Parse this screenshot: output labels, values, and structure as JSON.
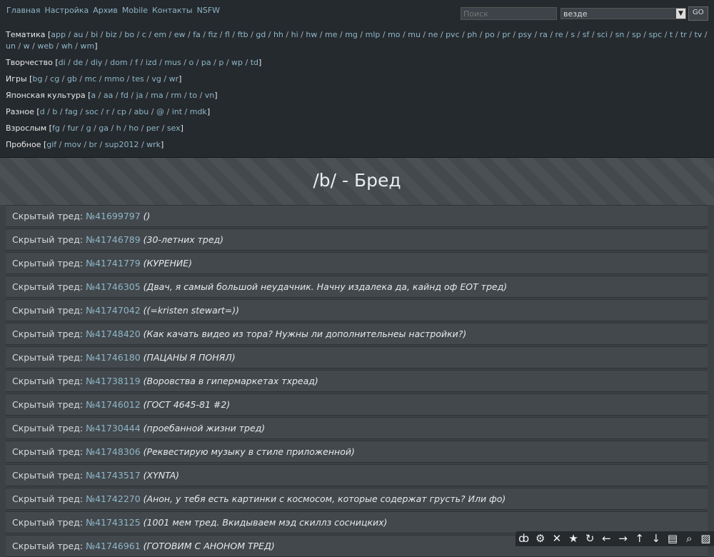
{
  "nav": [
    "Главная",
    "Настройка",
    "Архив",
    "Mobile",
    "Контакты",
    "NSFW"
  ],
  "search": {
    "placeholder": "Поиск",
    "scope": "везде",
    "go": "GO"
  },
  "categories": [
    {
      "label": "Тематика",
      "boards": [
        "app",
        "au",
        "bi",
        "biz",
        "bo",
        "c",
        "em",
        "ew",
        "fa",
        "fiz",
        "fl",
        "ftb",
        "gd",
        "hh",
        "hi",
        "hw",
        "me",
        "mg",
        "mlp",
        "mo",
        "mu",
        "ne",
        "pvc",
        "ph",
        "po",
        "pr",
        "psy",
        "ra",
        "re",
        "s",
        "sf",
        "sci",
        "sn",
        "sp",
        "spc",
        "t",
        "tr",
        "tv",
        "un",
        "w",
        "web",
        "wh",
        "wm"
      ]
    },
    {
      "label": "Творчество",
      "boards": [
        "di",
        "de",
        "diy",
        "dom",
        "f",
        "izd",
        "mus",
        "o",
        "pa",
        "p",
        "wp",
        "td"
      ]
    },
    {
      "label": "Игры",
      "boards": [
        "bg",
        "cg",
        "gb",
        "mc",
        "mmo",
        "tes",
        "vg",
        "wr"
      ]
    },
    {
      "label": "Японская культура",
      "boards": [
        "a",
        "aa",
        "fd",
        "ja",
        "ma",
        "rm",
        "to",
        "vn"
      ]
    },
    {
      "label": "Разное",
      "boards": [
        "d",
        "b",
        "fag",
        "soc",
        "r",
        "cp",
        "abu",
        "@",
        "int",
        "mdk"
      ]
    },
    {
      "label": "Взрослым",
      "boards": [
        "fg",
        "fur",
        "g",
        "ga",
        "h",
        "ho",
        "per",
        "sex"
      ]
    },
    {
      "label": "Пробное",
      "boards": [
        "gif",
        "mov",
        "br",
        "sup2012",
        "wrk"
      ]
    }
  ],
  "board_title": "/b/ - Бред",
  "hidden_prefix": "Скрытый тред: ",
  "threads": [
    {
      "num": "№41699797",
      "subject": "()"
    },
    {
      "num": "№41746789",
      "subject": "(30-летних тред)"
    },
    {
      "num": "№41741779",
      "subject": "(КУРЕНИЕ)"
    },
    {
      "num": "№41746305",
      "subject": "(Двач, я самый большой неудачник. Начну издалека да, кайнд оф ЕОТ тред)"
    },
    {
      "num": "№41747042",
      "subject": "((=kristen stewart=))"
    },
    {
      "num": "№41748420",
      "subject": "(Как качать видео из тора? Нужны ли дополнительнеы настройки?)"
    },
    {
      "num": "№41746180",
      "subject": "(ПАЦАНЫ Я ПОНЯЛ)"
    },
    {
      "num": "№41738119",
      "subject": "(Воровства в гипермаркетах тхреад)"
    },
    {
      "num": "№41746012",
      "subject": "(ГОСТ 4645-81 #2)"
    },
    {
      "num": "№41730444",
      "subject": "(проебанной жизни тред)"
    },
    {
      "num": "№41748306",
      "subject": "(Реквестирую музыку в стиле приложенной)"
    },
    {
      "num": "№41743517",
      "subject": "(XYNTA)"
    },
    {
      "num": "№41742270",
      "subject": "(Анон, у тебя есть картинки с космосом, которые содержат грусть? Или фо)"
    },
    {
      "num": "№41743125",
      "subject": "(1001 мем тред. Вкидываем мэд скиллз сосницких)"
    },
    {
      "num": "№41746961",
      "subject": "(ГОТОВИМ С АНОНОМ ТРЕД)"
    }
  ],
  "toolbar_icons": [
    {
      "name": "dollchan-logo-icon",
      "glyph": "ȸ"
    },
    {
      "name": "settings-gear-icon",
      "glyph": "⚙"
    },
    {
      "name": "close-x-icon",
      "glyph": "✕"
    },
    {
      "name": "favorites-star-icon",
      "glyph": "★"
    },
    {
      "name": "refresh-icon",
      "glyph": "↻"
    },
    {
      "name": "arrow-left-icon",
      "glyph": "←"
    },
    {
      "name": "arrow-right-icon",
      "glyph": "→"
    },
    {
      "name": "arrow-up-icon",
      "glyph": "↑"
    },
    {
      "name": "arrow-down-icon",
      "glyph": "↓"
    },
    {
      "name": "catalog-icon",
      "glyph": "▤"
    },
    {
      "name": "search-zoom-icon",
      "glyph": "⌕"
    },
    {
      "name": "expand-images-icon",
      "glyph": "▨"
    }
  ]
}
